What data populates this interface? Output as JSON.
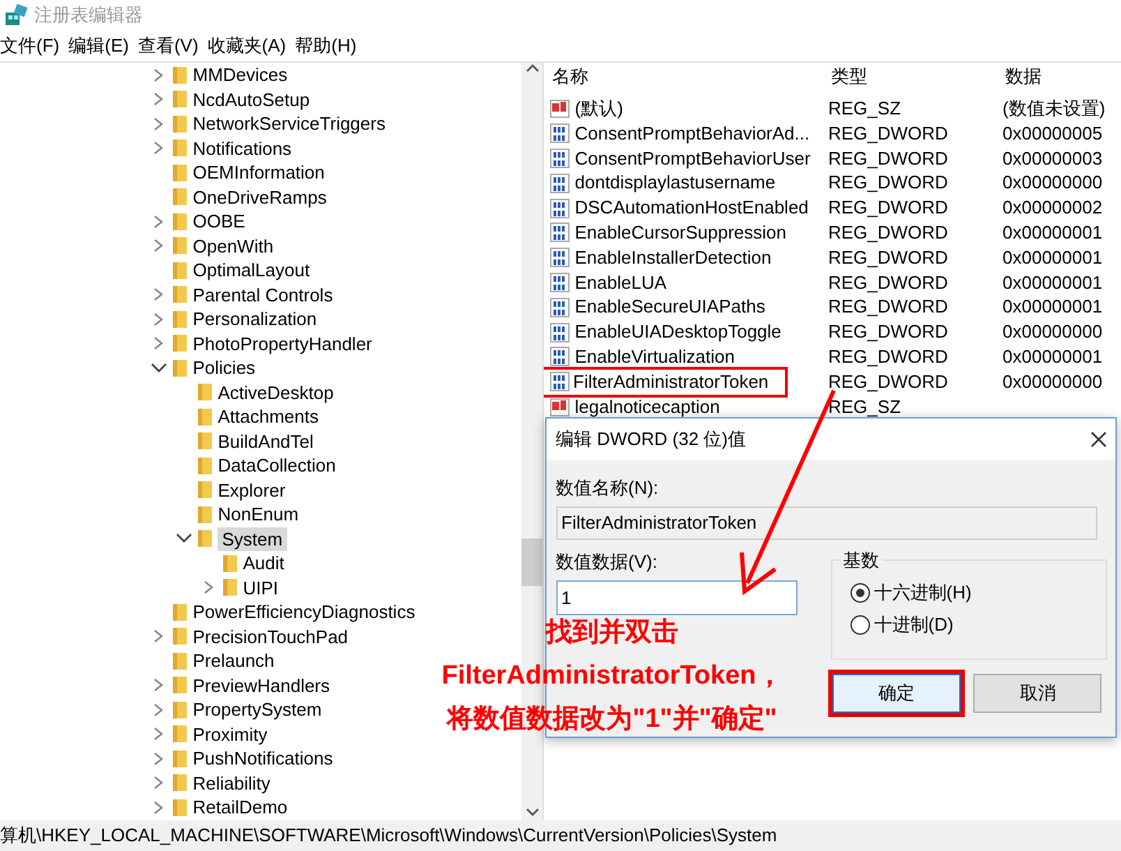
{
  "window": {
    "title": "注册表编辑器"
  },
  "menu": [
    "文件(F)",
    "编辑(E)",
    "查看(V)",
    "收藏夹(A)",
    "帮助(H)"
  ],
  "tree": [
    {
      "label": "MMDevices",
      "expanded": false,
      "selected": false
    },
    {
      "label": "NcdAutoSetup",
      "expanded": false,
      "selected": false
    },
    {
      "label": "NetworkServiceTriggers",
      "expanded": false,
      "selected": false
    },
    {
      "label": "Notifications",
      "expanded": false,
      "selected": false
    },
    {
      "label": "OEMInformation",
      "selected": false
    },
    {
      "label": "OneDriveRamps",
      "selected": false
    },
    {
      "label": "OOBE",
      "expanded": false,
      "selected": false
    },
    {
      "label": "OpenWith",
      "expanded": false,
      "selected": false
    },
    {
      "label": "OptimalLayout",
      "selected": false
    },
    {
      "label": "Parental Controls",
      "expanded": false,
      "selected": false
    },
    {
      "label": "Personalization",
      "expanded": false,
      "selected": false
    },
    {
      "label": "PhotoPropertyHandler",
      "expanded": false,
      "selected": false
    },
    {
      "label": "Policies",
      "expanded": true,
      "selected": false,
      "children": [
        {
          "label": "ActiveDesktop",
          "selected": false
        },
        {
          "label": "Attachments",
          "selected": false
        },
        {
          "label": "BuildAndTel",
          "selected": false
        },
        {
          "label": "DataCollection",
          "selected": false
        },
        {
          "label": "Explorer",
          "selected": false
        },
        {
          "label": "NonEnum",
          "selected": false
        },
        {
          "label": "System",
          "expanded": true,
          "selected": true,
          "children": [
            {
              "label": "Audit",
              "selected": false
            },
            {
              "label": "UIPI",
              "expanded": false,
              "selected": false
            }
          ]
        }
      ]
    },
    {
      "label": "PowerEfficiencyDiagnostics",
      "selected": false
    },
    {
      "label": "PrecisionTouchPad",
      "expanded": false,
      "selected": false
    },
    {
      "label": "Prelaunch",
      "selected": false
    },
    {
      "label": "PreviewHandlers",
      "expanded": false,
      "selected": false
    },
    {
      "label": "PropertySystem",
      "expanded": false,
      "selected": false
    },
    {
      "label": "Proximity",
      "expanded": false,
      "selected": false
    },
    {
      "label": "PushNotifications",
      "expanded": false,
      "selected": false
    },
    {
      "label": "Reliability",
      "expanded": false,
      "selected": false
    },
    {
      "label": "RetailDemo",
      "expanded": false,
      "selected": false
    }
  ],
  "values": {
    "columns": [
      "名称",
      "类型",
      "数据"
    ],
    "rows": [
      {
        "kind": "string",
        "name": "(默认)",
        "type": "REG_SZ",
        "data": "(数值未设置)",
        "highlighted": false
      },
      {
        "kind": "dword",
        "name": "ConsentPromptBehaviorAd...",
        "type": "REG_DWORD",
        "data": "0x00000005",
        "highlighted": false
      },
      {
        "kind": "dword",
        "name": "ConsentPromptBehaviorUser",
        "type": "REG_DWORD",
        "data": "0x00000003",
        "highlighted": false
      },
      {
        "kind": "dword",
        "name": "dontdisplaylastusername",
        "type": "REG_DWORD",
        "data": "0x00000000",
        "highlighted": false
      },
      {
        "kind": "dword",
        "name": "DSCAutomationHostEnabled",
        "type": "REG_DWORD",
        "data": "0x00000002",
        "highlighted": false
      },
      {
        "kind": "dword",
        "name": "EnableCursorSuppression",
        "type": "REG_DWORD",
        "data": "0x00000001",
        "highlighted": false
      },
      {
        "kind": "dword",
        "name": "EnableInstallerDetection",
        "type": "REG_DWORD",
        "data": "0x00000001",
        "highlighted": false
      },
      {
        "kind": "dword",
        "name": "EnableLUA",
        "type": "REG_DWORD",
        "data": "0x00000001",
        "highlighted": false
      },
      {
        "kind": "dword",
        "name": "EnableSecureUIAPaths",
        "type": "REG_DWORD",
        "data": "0x00000001",
        "highlighted": false
      },
      {
        "kind": "dword",
        "name": "EnableUIADesktopToggle",
        "type": "REG_DWORD",
        "data": "0x00000000",
        "highlighted": false
      },
      {
        "kind": "dword",
        "name": "EnableVirtualization",
        "type": "REG_DWORD",
        "data": "0x00000001",
        "highlighted": false
      },
      {
        "kind": "dword",
        "name": "FilterAdministratorToken",
        "type": "REG_DWORD",
        "data": "0x00000000",
        "highlighted": true
      },
      {
        "kind": "string",
        "name": "legalnoticecaption",
        "type": "REG_SZ",
        "highlighted": false
      }
    ]
  },
  "dialog": {
    "title": "编辑 DWORD (32 位)值",
    "name_label": "数值名称(N):",
    "name_value": "FilterAdministratorToken",
    "data_label": "数值数据(V):",
    "data_value": "1",
    "base": {
      "label": "基数",
      "options": [
        {
          "label": "十六进制(H)",
          "selected": true
        },
        {
          "label": "十进制(D)",
          "selected": false
        }
      ]
    },
    "buttons": [
      {
        "label": "确定",
        "highlighted": true
      },
      {
        "label": "取消",
        "highlighted": false
      }
    ]
  },
  "annotation": {
    "lines": [
      "找到并双击",
      "FilterAdministratorToken，",
      "将数值数据改为\"1\"并\"确定\""
    ]
  },
  "status_bar": "算机\\HKEY_LOCAL_MACHINE\\SOFTWARE\\Microsoft\\Windows\\CurrentVersion\\Policies\\System"
}
